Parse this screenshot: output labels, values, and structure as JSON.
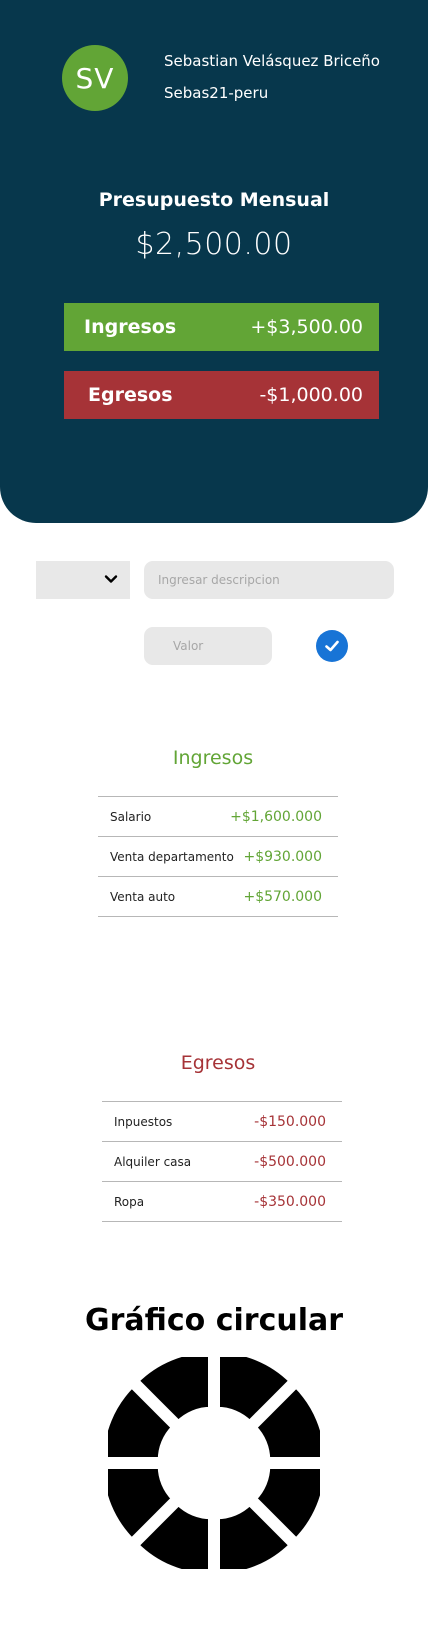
{
  "user": {
    "initials": "SV",
    "name": "Sebastian Velásquez Briceño",
    "handle": "Sebas21-peru"
  },
  "budget": {
    "title": "Presupuesto Mensual",
    "amount": "$2,500.00"
  },
  "summary": {
    "income_label": "Ingresos",
    "income_value": "+$3,500.00",
    "expense_label": "Egresos",
    "expense_value": "-$1,000.00"
  },
  "form": {
    "type_selected": "",
    "description_placeholder": "Ingresar descripcion",
    "value_placeholder": "Valor"
  },
  "income": {
    "title": "Ingresos",
    "rows": [
      {
        "description": "Salario",
        "amount": "+$1,600.000"
      },
      {
        "description": "Venta departamento",
        "amount": "+$930.000"
      },
      {
        "description": "Venta auto",
        "amount": "+$570.000"
      }
    ]
  },
  "expenses": {
    "title": "Egresos",
    "rows": [
      {
        "description": "Inpuestos",
        "amount": "-$150.000"
      },
      {
        "description": "Alquiler casa",
        "amount": "-$500.000"
      },
      {
        "description": "Ropa",
        "amount": "-$350.000"
      }
    ]
  },
  "chart": {
    "title": "Gráfico circular",
    "segments": 8
  },
  "colors": {
    "header_bg": "#07374c",
    "income": "#62a536",
    "expense": "#a63337",
    "confirm": "#1874d6",
    "input_bg": "#e8e8e8"
  }
}
